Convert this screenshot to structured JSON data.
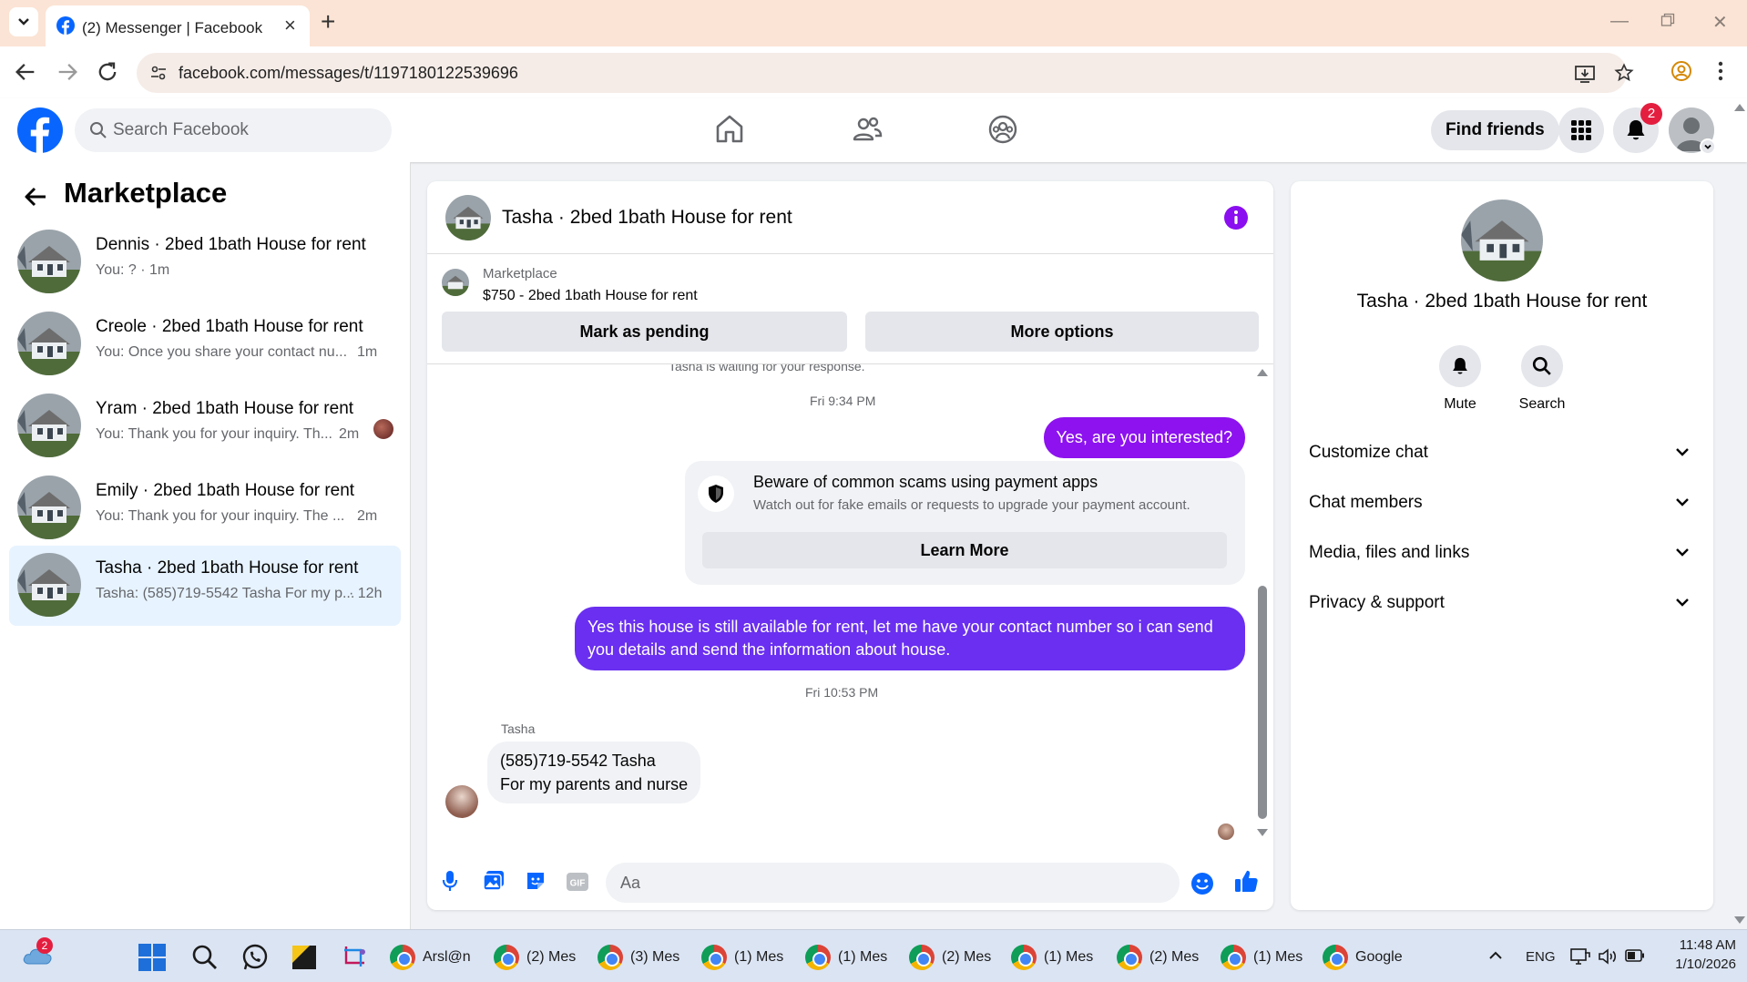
{
  "browser": {
    "tab_title": "(2) Messenger | Facebook",
    "url": "facebook.com/messages/t/1197180122539696"
  },
  "fb": {
    "search_placeholder": "Search Facebook",
    "find_friends": "Find friends",
    "notification_count": "2"
  },
  "left": {
    "title": "Marketplace",
    "conversations": [
      {
        "name": "Dennis · 2bed 1bath House for rent",
        "preview": "You: ? · 1m",
        "time": ""
      },
      {
        "name": "Creole · 2bed 1bath House for rent",
        "preview": "You: Once you share your contact nu...",
        "time": "1m"
      },
      {
        "name": "Yram · 2bed 1bath House for rent",
        "preview": "You: Thank you for your inquiry. Th...",
        "time": "2m"
      },
      {
        "name": "Emily · 2bed 1bath House for rent",
        "preview": "You: Thank you for your inquiry. The ...",
        "time": "2m"
      },
      {
        "name": "Tasha · 2bed 1bath House for rent",
        "preview": "Tasha: (585)719-5542 Tasha For my p...",
        "time": "· 12h"
      }
    ]
  },
  "chat": {
    "title": "Tasha · 2bed 1bath House for rent",
    "listing_source": "Marketplace",
    "listing_price": "$750 - 2bed 1bath House for rent",
    "mark_pending": "Mark as pending",
    "more_options": "More options",
    "waiting": "Tasha is waiting for your response.",
    "timestamp1": "Fri 9:34 PM",
    "msg1": "Yes, are you interested?",
    "scam_title": "Beware of common scams using payment apps",
    "scam_body": "Watch out for fake emails or requests to upgrade your payment account.",
    "learn_more": "Learn More",
    "msg2": "Yes this house is still available for rent, let me have your contact number so i can send you details and send the information about house.",
    "timestamp2": "Fri 10:53 PM",
    "sender": "Tasha",
    "msg3_line1": "(585)719-5542 Tasha",
    "msg3_line2": "For my parents and nurse",
    "composer_placeholder": "Aa"
  },
  "right": {
    "title": "Tasha · 2bed 1bath House for rent",
    "mute": "Mute",
    "search": "Search",
    "rows": [
      "Customize chat",
      "Chat members",
      "Media, files and links",
      "Privacy & support"
    ]
  },
  "taskbar": {
    "weather_badge": "2",
    "items": [
      "Arsl@n",
      "(2) Mes",
      "(3) Mes",
      "(1) Mes",
      "(1) Mes",
      "(2) Mes",
      "(1) Mes",
      "(2) Mes",
      "(1) Mes",
      "Google"
    ],
    "lang": "ENG",
    "time": "11:48 AM",
    "date": "1/10/2026"
  },
  "colors": {
    "fb_blue": "#0866ff",
    "outgoing_bubble": "#8a0ef0",
    "notification_red": "#e41e3f",
    "tabbar": "#fbe4d5"
  }
}
